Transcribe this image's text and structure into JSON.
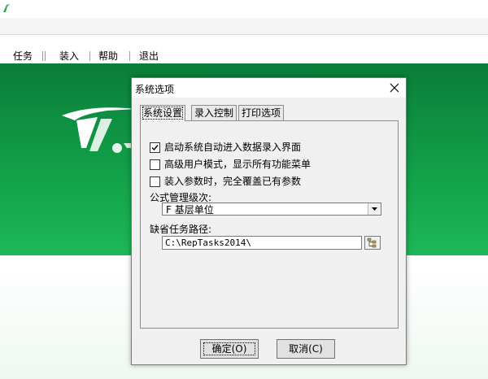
{
  "menubar": {
    "items": [
      "任务",
      "装入",
      "帮助",
      "退出"
    ]
  },
  "dialog": {
    "title": "系统选项",
    "tabs": [
      "系统设置",
      "录入控制",
      "打印选项"
    ],
    "options": [
      {
        "label": "启动系统自动进入数据录入界面",
        "checked": true
      },
      {
        "label": "高级用户模式，显示所有功能菜单",
        "checked": false
      },
      {
        "label": "装入参数时，完全覆盖已有参数",
        "checked": false
      }
    ],
    "formula_level_label": "公式管理级次:",
    "formula_level_value": "F 基层单位",
    "task_path_label": "缺省任务路径:",
    "task_path_value": "C:\\RepTasks2014\\",
    "ok_label": "确定(O)",
    "cancel_label": "取消(C)"
  },
  "colors": {
    "banner_green": "#13a24a",
    "app_icon_green": "#2fa84f"
  },
  "icons": {
    "app": "app-icon",
    "close": "close-icon",
    "dropdown": "chevron-down-icon",
    "browse": "folder-tree-icon"
  }
}
